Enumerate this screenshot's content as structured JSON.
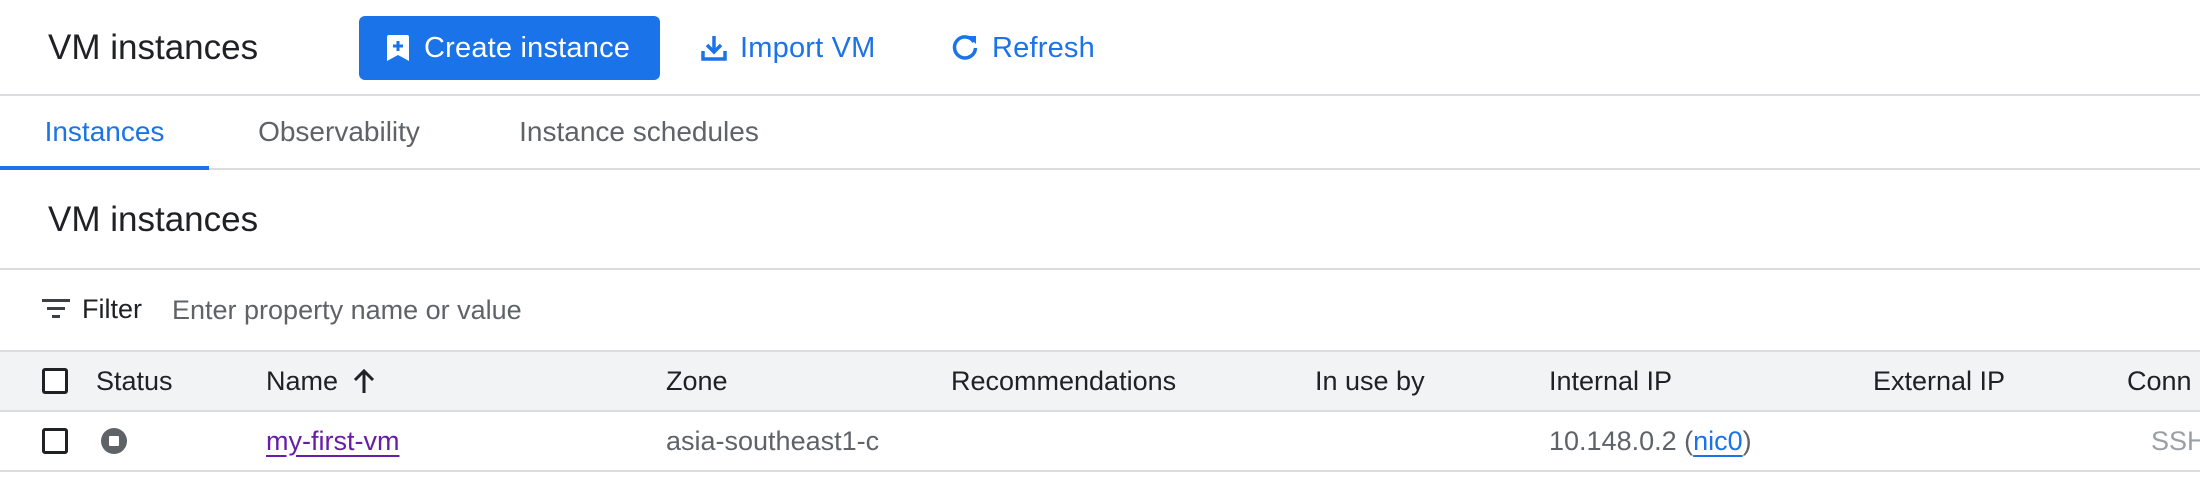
{
  "header": {
    "title": "VM instances",
    "create_label": "Create instance",
    "import_label": "Import VM",
    "refresh_label": "Refresh"
  },
  "tabs": [
    {
      "label": "Instances",
      "active": true
    },
    {
      "label": "Observability",
      "active": false
    },
    {
      "label": "Instance schedules",
      "active": false
    }
  ],
  "section": {
    "title": "VM instances"
  },
  "filter": {
    "label": "Filter",
    "placeholder": "Enter property name or value",
    "value": ""
  },
  "table": {
    "columns": {
      "status": "Status",
      "name": "Name",
      "zone": "Zone",
      "recommendations": "Recommendations",
      "in_use_by": "In use by",
      "internal_ip": "Internal IP",
      "external_ip": "External IP",
      "connect": "Conn"
    },
    "sort": {
      "column": "Name",
      "direction": "ascending",
      "icon": "arrow-up-icon"
    },
    "rows": [
      {
        "status_icon": "stopped-status-icon",
        "name": "my-first-vm",
        "zone": "asia-southeast1-c",
        "recommendations": "",
        "in_use_by": "",
        "internal_ip": "10.148.0.2 (",
        "nic": "nic0",
        "internal_ip_suffix": ")",
        "external_ip": "",
        "connect": "SSH"
      }
    ]
  },
  "colors": {
    "primary": "#1a73e8",
    "link_visited": "#681da8",
    "text": "#202124",
    "muted": "#5f6368",
    "divider": "#dadce0",
    "table_header_bg": "#f1f3f4"
  }
}
